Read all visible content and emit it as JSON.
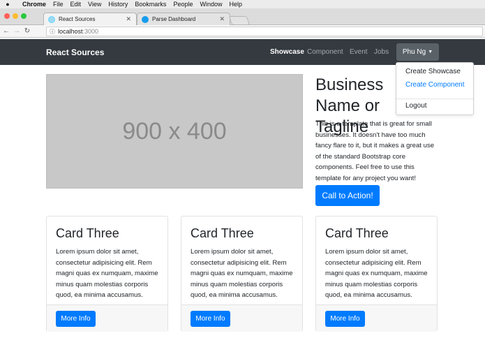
{
  "mac_menu": {
    "app": "Chrome",
    "items": [
      "File",
      "Edit",
      "View",
      "History",
      "Bookmarks",
      "People",
      "Window",
      "Help"
    ]
  },
  "browser": {
    "tabs": [
      {
        "title": "React Sources"
      },
      {
        "title": "Parse Dashboard"
      }
    ],
    "url_host": "localhost",
    "url_port": ":3000"
  },
  "navbar": {
    "brand": "React Sources",
    "links": [
      "Showcase",
      "Component",
      "Event",
      "Jobs"
    ],
    "active_link": "Showcase",
    "user": "Phu Ng"
  },
  "dropdown": {
    "items": [
      "Create Showcase",
      "Create Component",
      "Logout"
    ],
    "highlighted": "Create Component"
  },
  "hero": {
    "image_placeholder": "900 x 400",
    "title": "Business Name or Tagline",
    "text": "This is a template that is great for small businesses. It doesn't have too much fancy flare to it, but it makes a great use of the standard Bootstrap core components. Feel free to use this template for any project you want!",
    "cta_label": "Call to Action!"
  },
  "cards": [
    {
      "title": "Card Three",
      "text": "Lorem ipsum dolor sit amet, consectetur adipisicing elit. Rem magni quas ex numquam, maxime minus quam molestias corporis quod, ea minima accusamus.",
      "button": "More Info"
    },
    {
      "title": "Card Three",
      "text": "Lorem ipsum dolor sit amet, consectetur adipisicing elit. Rem magni quas ex numquam, maxime minus quam molestias corporis quod, ea minima accusamus.",
      "button": "More Info"
    },
    {
      "title": "Card Three",
      "text": "Lorem ipsum dolor sit amet, consectetur adipisicing elit. Rem magni quas ex numquam, maxime minus quam molestias corporis quod, ea minima accusamus.",
      "button": "More Info"
    }
  ],
  "colors": {
    "navbar": "#343a40",
    "primary": "#007bff"
  }
}
